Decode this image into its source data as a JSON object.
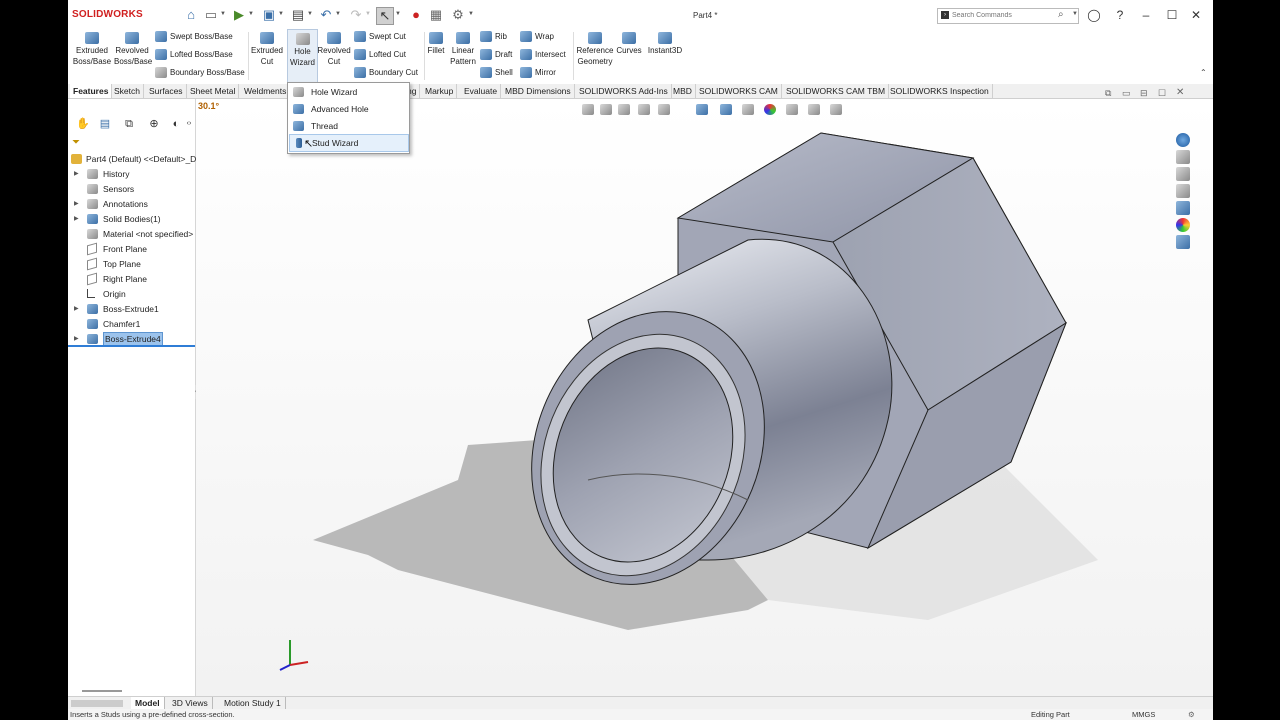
{
  "app": {
    "logo": "SOLIDWORKS",
    "doc_title": "Part4 *"
  },
  "search": {
    "placeholder": "Search Commands"
  },
  "ribbon": {
    "extruded_boss": "Extruded Boss/Base",
    "revolved_boss": "Revolved Boss/Base",
    "swept_boss": "Swept Boss/Base",
    "lofted_boss": "Lofted Boss/Base",
    "boundary_boss": "Boundary Boss/Base",
    "extruded_cut": "Extruded Cut",
    "hole_wizard": "Hole Wizard",
    "revolved_cut": "Revolved Cut",
    "swept_cut": "Swept Cut",
    "lofted_cut": "Lofted Cut",
    "boundary_cut": "Boundary Cut",
    "fillet": "Fillet",
    "linear_pattern": "Linear Pattern",
    "rib": "Rib",
    "draft": "Draft",
    "shell": "Shell",
    "wrap": "Wrap",
    "intersect": "Intersect",
    "mirror": "Mirror",
    "reference_geometry": "Reference Geometry",
    "curves": "Curves",
    "instant3d": "Instant3D"
  },
  "tabs": [
    "Features",
    "Sketch",
    "Surfaces",
    "Sheet Metal",
    "Weldments",
    "ng",
    "Markup",
    "Evaluate",
    "MBD Dimensions",
    "SOLIDWORKS Add-Ins",
    "MBD",
    "SOLIDWORKS CAM",
    "SOLIDWORKS CAM TBM",
    "SOLIDWORKS Inspection"
  ],
  "hole_wizard_menu": [
    "Hole Wizard",
    "Advanced Hole",
    "Thread",
    "Stud Wizard"
  ],
  "tree": {
    "root": "Part4 (Default) <<Default>_D",
    "items": [
      "History",
      "Sensors",
      "Annotations",
      "Solid Bodies(1)",
      "Material <not specified>",
      "Front Plane",
      "Top Plane",
      "Right Plane",
      "Origin",
      "Boss-Extrude1",
      "Chamfer1",
      "Boss-Extrude4"
    ]
  },
  "viewport": {
    "angle": "30.1°"
  },
  "bottom_tabs": [
    "Model",
    "3D Views",
    "Motion Study 1"
  ],
  "status": {
    "message": "Inserts a Studs using a pre-defined cross-section.",
    "mode": "Editing Part",
    "units": "MMGS"
  },
  "colors": {
    "accent": "#3a6fa8",
    "brand_red": "#d02020",
    "selection": "#9cc3ec"
  }
}
